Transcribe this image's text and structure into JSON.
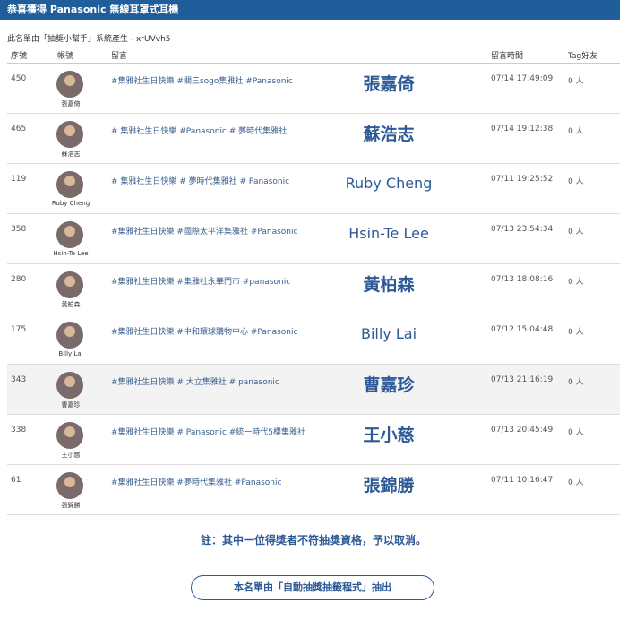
{
  "header": {
    "title": "恭喜獲得 Panasonic 無線耳罩式耳機"
  },
  "subtitle": "此名單由「抽獎小幫手」系統產生 - xrUVvh5",
  "columns": {
    "seq": "序號",
    "account": "帳號",
    "comment": "留言",
    "time": "留言時間",
    "tag": "Tag好友"
  },
  "rows": [
    {
      "seq": "450",
      "user": "張嘉倚",
      "comment": "#集雅社生日快樂 #關三sogo集雅社 #Panasonic",
      "winner": "張嘉倚",
      "time": "07/14 17:49:09",
      "tag": "0 人"
    },
    {
      "seq": "465",
      "user": "蘇浩志",
      "comment": "# 集雅社生日快樂 #Panasonic # 夢時代集雅社",
      "winner": "蘇浩志",
      "time": "07/14 19:12:38",
      "tag": "0 人"
    },
    {
      "seq": "119",
      "user": "Ruby Cheng",
      "comment": "# 集雅社生日快樂 # 夢時代集雅社 # Panasonic",
      "winner": "Ruby Cheng",
      "time": "07/11 19:25:52",
      "tag": "0 人"
    },
    {
      "seq": "358",
      "user": "Hsin-Te Lee",
      "comment": "#集雅社生日快樂 #國際太平洋集雅社 #Panasonic",
      "winner": "Hsin-Te Lee",
      "time": "07/13 23:54:34",
      "tag": "0 人"
    },
    {
      "seq": "280",
      "user": "黃柏森",
      "comment": "#集雅社生日快樂 #集雅社永華門市 #panasonic",
      "winner": "黃柏森",
      "time": "07/13 18:08:16",
      "tag": "0 人"
    },
    {
      "seq": "175",
      "user": "Billy Lai",
      "comment": "#集雅社生日快樂 #中和環球購物中心 #Panasonic",
      "winner": "Billy Lai",
      "time": "07/12 15:04:48",
      "tag": "0 人"
    },
    {
      "seq": "343",
      "user": "曹嘉珍",
      "comment": "#集雅社生日快樂 # 大立集雅社 # panasonic",
      "winner": "曹嘉珍",
      "time": "07/13 21:16:19",
      "tag": "0 人"
    },
    {
      "seq": "338",
      "user": "王小慈",
      "comment": "#集雅社生日快樂 # Panasonic #統一時代5樓集雅社",
      "winner": "王小慈",
      "time": "07/13 20:45:49",
      "tag": "0 人"
    },
    {
      "seq": "61",
      "user": "張錦勝",
      "comment": "#集雅社生日快樂 #夢時代集雅社 #Panasonic",
      "winner": "張錦勝",
      "time": "07/11 10:16:47",
      "tag": "0 人"
    }
  ],
  "note": "註：其中一位得獎者不符抽獎資格，予以取消。",
  "pill": "本名單由「自動抽獎抽籤程式」抽出"
}
